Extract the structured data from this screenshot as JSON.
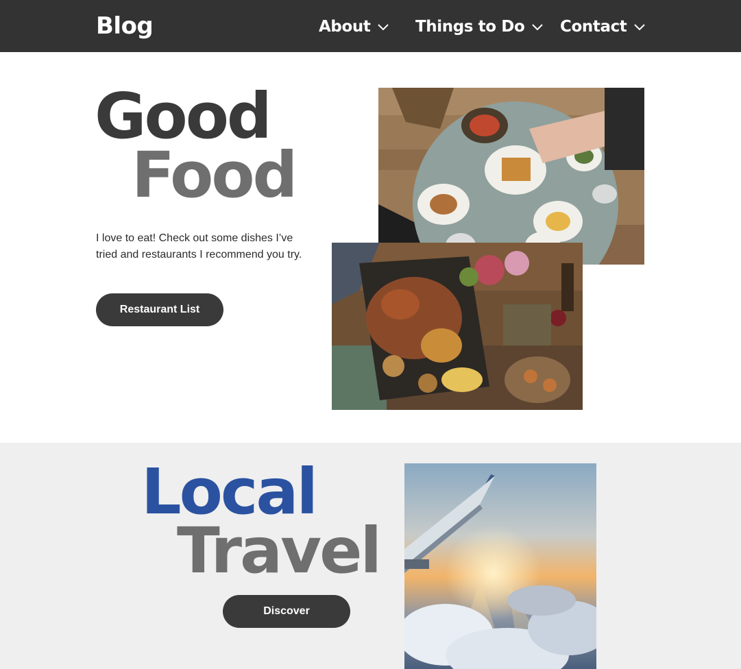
{
  "header": {
    "brand": "Blog",
    "nav": [
      {
        "label": "About",
        "icon": "chevron-down-icon"
      },
      {
        "label": "Things to Do",
        "icon": "chevron-down-icon"
      },
      {
        "label": "Contact",
        "icon": "chevron-down-icon"
      }
    ]
  },
  "food": {
    "title_line1": "Good",
    "title_line2": "Food",
    "description": "I love to eat! Check out some dishes I’ve tried and restaurants I recommend you try.",
    "button_label": "Restaurant List",
    "images": [
      "food-table-photo",
      "food-platter-photo"
    ]
  },
  "travel": {
    "title_line1": "Local",
    "title_line2": "Travel",
    "button_label": "Discover",
    "image": "airplane-wing-photo"
  },
  "colors": {
    "header_bg": "#333333",
    "heading_dark": "#3a3a3a",
    "heading_gray": "#6f6f6f",
    "accent_blue": "#2b52a0",
    "button_bg": "#3a3a3a",
    "section_bg": "#efefef"
  }
}
